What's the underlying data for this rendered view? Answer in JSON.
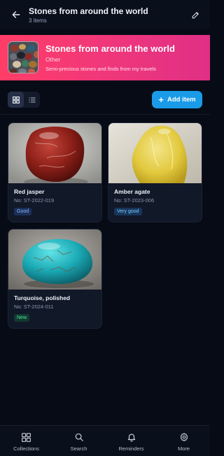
{
  "header": {
    "title": "Stones from around the world",
    "subtitle": "3 items",
    "back_icon": "arrow-left-icon",
    "edit_icon": "pencil-icon"
  },
  "banner": {
    "title": "Stones from around the world",
    "category": "Other",
    "description": "Semi-precious stones and finds from my travels",
    "gradient": [
      "#ff3d67",
      "#e02f86"
    ]
  },
  "toolbar": {
    "view_grid_icon": "grid-icon",
    "view_list_icon": "list-icon",
    "active_view": "grid",
    "add_label": "Add item",
    "accent": "#1a9be8"
  },
  "items": [
    {
      "name": "Red jasper",
      "number": "No: ST-2022-019",
      "condition": "Good"
    },
    {
      "name": "Amber agate",
      "number": "No: ST-2023-006",
      "condition": "Very good"
    },
    {
      "name": "Turquoise, polished",
      "number": "No: ST-2024-011",
      "condition": "New"
    }
  ],
  "nav": [
    {
      "label": "Collections",
      "icon": "grid-icon"
    },
    {
      "label": "Search",
      "icon": "search-icon"
    },
    {
      "label": "Reminders",
      "icon": "bell-icon"
    },
    {
      "label": "More",
      "icon": "gear-icon"
    }
  ]
}
